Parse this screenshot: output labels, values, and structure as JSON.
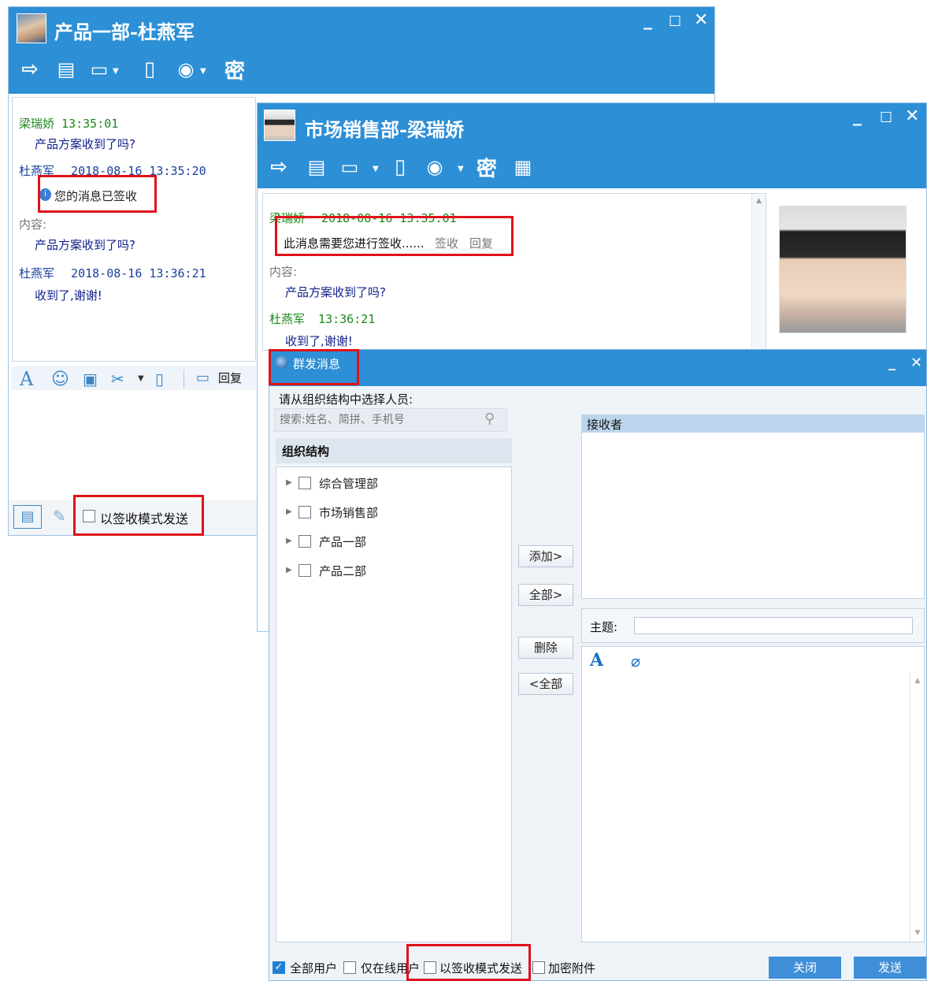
{
  "window1": {
    "title": "产品一部-杜燕军",
    "toolbar": {
      "secret_label": "密"
    },
    "messages": [
      {
        "sender": "梁瑞娇",
        "time": "13:35:01",
        "text": "产品方案收到了吗?"
      },
      {
        "sender": "杜燕军",
        "time": "2018-08-16 13:35:20",
        "receipt": "您的消息已签收"
      },
      {
        "content_label": "内容:",
        "text": "产品方案收到了吗?"
      },
      {
        "sender": "杜燕军",
        "time": "2018-08-16 13:36:21",
        "text": "收到了,谢谢!"
      }
    ],
    "compose_toolbar": {
      "reply_label": "回复"
    },
    "sign_mode_label": "以签收模式发送"
  },
  "window2": {
    "title": "市场销售部-梁瑞娇",
    "toolbar": {
      "secret_label": "密"
    },
    "messages": [
      {
        "sender": "梁瑞娇",
        "time": "2018-08-16 13:35:01"
      },
      {
        "notice": "此消息需要您进行签收......",
        "sign_link": "签收",
        "reply_link": "回复"
      },
      {
        "content_label": "内容:",
        "text": "产品方案收到了吗?"
      },
      {
        "sender": "杜燕军",
        "time": "13:36:21",
        "text": "收到了,谢谢!"
      }
    ]
  },
  "broadcast": {
    "title": "群发消息",
    "instruction": "请从组织结构中选择人员:",
    "search_placeholder": "搜索:姓名、简拼、手机号",
    "org_tab": "组织结构",
    "departments": [
      "综合管理部",
      "市场销售部",
      "产品一部",
      "产品二部"
    ],
    "buttons": {
      "add": "添加>",
      "add_all": "全部>",
      "remove": "删除",
      "remove_all": "<全部"
    },
    "receivers_header": "接收者",
    "subject_label": "主题:",
    "options": {
      "all_users": "全部用户",
      "online_only": "仅在线用户",
      "sign_mode": "以签收模式发送",
      "encrypt_attachment": "加密附件"
    },
    "close_label": "关闭",
    "send_label": "发送"
  },
  "colors": {
    "titlebar": "#2d8fd5",
    "highlight": "#e0121b",
    "sender_green": "#1a8a1a",
    "sender_blue": "#1a3fa0"
  }
}
